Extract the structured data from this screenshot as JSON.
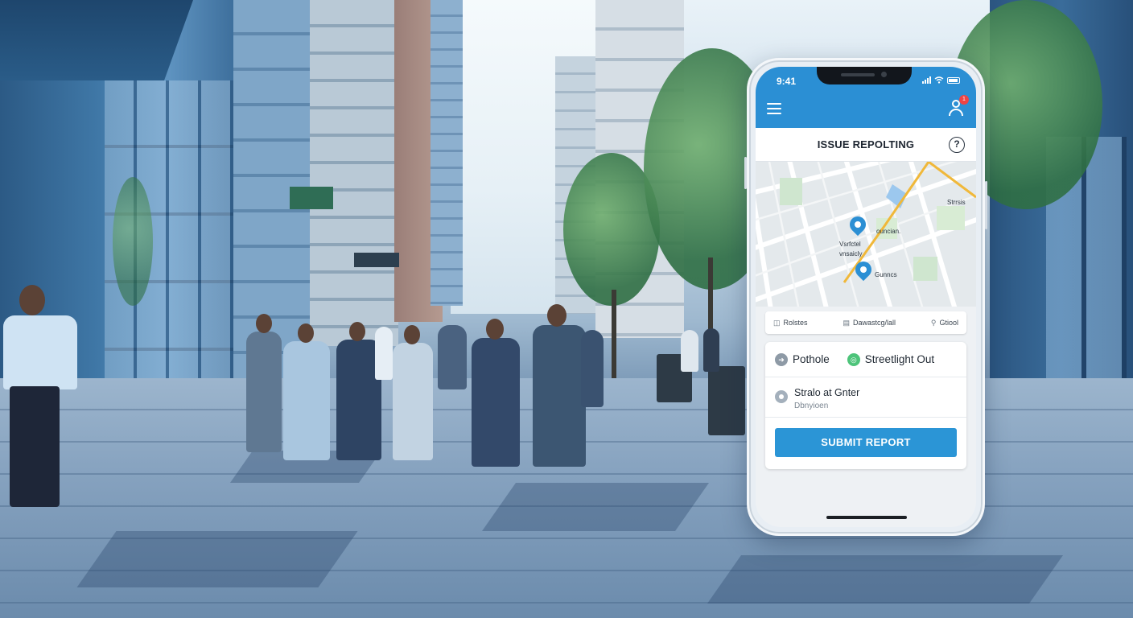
{
  "phone": {
    "status_time": "9:41",
    "notification_count": "1",
    "page_title": "ISSUE REPOLTING",
    "help_glyph": "?",
    "map": {
      "labels": [
        "Strrsis",
        "ouncian.",
        "Vsrfctel",
        "vnsaicly",
        "Gunncs"
      ]
    },
    "toolbar": {
      "item1": "Rolstes",
      "item2": "Dawastcg/lall",
      "item3": "Gtiool"
    },
    "categories": {
      "pothole": "Pothole",
      "streetlight": "Streetlight Out"
    },
    "location": {
      "title": "Stralo at Gnter",
      "subtitle": "Dbnyioen"
    },
    "submit_label": "SUBMIT REPORT"
  },
  "colors": {
    "app_blue": "#2b8fd4",
    "button_blue": "#2b95d6",
    "map_route": "#f0b83a",
    "chip_green": "#4dc47a"
  },
  "icons": [
    "menu-icon",
    "user-icon",
    "help-icon",
    "map-pin-icon",
    "location-icon",
    "pothole-icon",
    "streetlight-icon"
  ]
}
